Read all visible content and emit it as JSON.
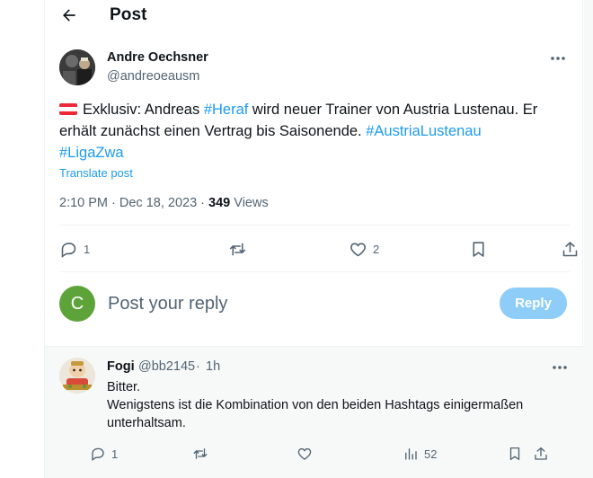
{
  "header": {
    "title": "Post"
  },
  "tweet": {
    "author_name": "Andre Oechsner",
    "author_handle": "@andreoeausm",
    "text_part1": "Exklusiv: Andreas ",
    "hashtag1": "#Heraf",
    "text_part2": " wird neuer Trainer von Austria Lustenau. Er erhält zunächst einen Vertrag bis Saisonende. ",
    "hashtag2": "#AustriaLustenau",
    "hashtag3": "#LigaZwa",
    "translate_label": "Translate post",
    "time": "2:10 PM",
    "separator": " · ",
    "date": "Dec 18, 2023",
    "views_count": "349",
    "views_label": " Views",
    "reply_count": "1",
    "like_count": "2",
    "flag_colors": [
      "#ed2939",
      "#ffffff",
      "#ed2939"
    ]
  },
  "composer": {
    "avatar_letter": "C",
    "avatar_color": "#5da33a",
    "placeholder": "Post your reply",
    "button_label": "Reply"
  },
  "reply": {
    "author_name": "Fogi",
    "author_handle": "@bb2145",
    "dot": "·",
    "time": "1h",
    "line1": "Bitter.",
    "line2": "Wenigstens ist die Kombination von den beiden Hashtags einigermaßen unterhaltsam.",
    "reply_count": "1",
    "views_count": "52"
  },
  "colors": {
    "accent": "#1d9bf0",
    "muted": "#536471",
    "reply_button_disabled": "#8ecdf8"
  },
  "icons": {
    "back": "arrow-left-icon",
    "more": "more-horizontal-icon",
    "reply": "comment-icon",
    "repost": "repost-icon",
    "like": "heart-icon",
    "bookmark": "bookmark-icon",
    "share": "share-icon",
    "analytics": "analytics-bars-icon"
  }
}
